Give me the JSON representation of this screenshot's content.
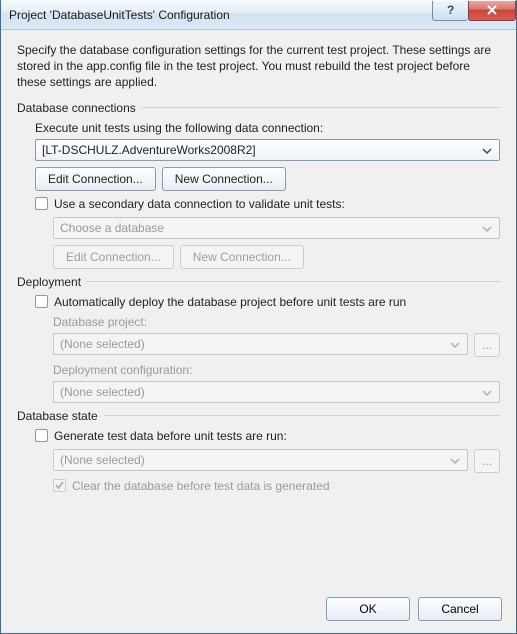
{
  "title": "Project 'DatabaseUnitTests' Configuration",
  "intro": "Specify the database configuration settings for the current test project. These settings are stored in the app.config file in the test project. You must rebuild the test project before these settings are applied.",
  "sections": {
    "db_conn": {
      "label": "Database connections",
      "execute_label": "Execute unit tests using the following data connection:",
      "primary_conn": "[LT-DSCHULZ.AdventureWorks2008R2]",
      "edit_btn": "Edit Connection...",
      "new_btn": "New Connection...",
      "secondary_cb": "Use a secondary data connection to validate unit tests:",
      "secondary_placeholder": "Choose a database",
      "secondary_edit": "Edit Connection...",
      "secondary_new": "New Connection..."
    },
    "deployment": {
      "label": "Deployment",
      "auto_cb": "Automatically deploy the database project before unit tests are run",
      "db_project_label": "Database project:",
      "db_project_value": "(None selected)",
      "browse": "...",
      "deploy_cfg_label": "Deployment configuration:",
      "deploy_cfg_value": "(None selected)"
    },
    "db_state": {
      "label": "Database state",
      "gen_cb": "Generate test data before unit tests are run:",
      "gen_value": "(None selected)",
      "browse": "...",
      "clear_cb": "Clear the database before test data is generated"
    }
  },
  "footer": {
    "ok": "OK",
    "cancel": "Cancel"
  }
}
